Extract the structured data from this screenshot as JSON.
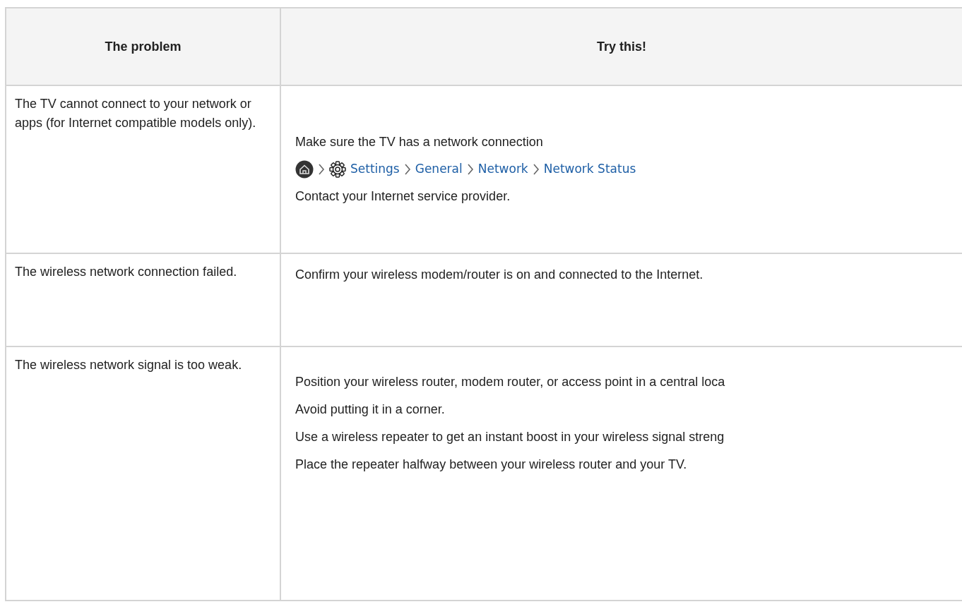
{
  "table": {
    "columns": [
      "The problem",
      "Try this!"
    ],
    "rows": [
      {
        "problem": "The TV cannot connect to your network or apps (for Internet compatible models only).",
        "solution": [
          {
            "kind": "text",
            "text": "Make sure the TV has a network connection"
          },
          {
            "kind": "path",
            "steps": [
              "Settings",
              "General",
              "Network",
              "Network Status"
            ]
          },
          {
            "kind": "text",
            "text": "Contact your Internet service provider."
          }
        ]
      },
      {
        "problem": "The wireless network connection failed.",
        "solution": [
          {
            "kind": "text",
            "text": "Confirm your wireless modem/router is on and connected to the Internet."
          }
        ]
      },
      {
        "problem": "The wireless network signal is too weak.",
        "solution": [
          {
            "kind": "text",
            "text": "Position your wireless router, modem router, or access point in a central loca"
          },
          {
            "kind": "text",
            "text": "Avoid putting it in a corner."
          },
          {
            "kind": "text",
            "text": "Use a wireless repeater to get an instant boost in your wireless signal streng"
          },
          {
            "kind": "text",
            "text": "Place the repeater halfway between your wireless router and your TV."
          }
        ]
      }
    ]
  }
}
